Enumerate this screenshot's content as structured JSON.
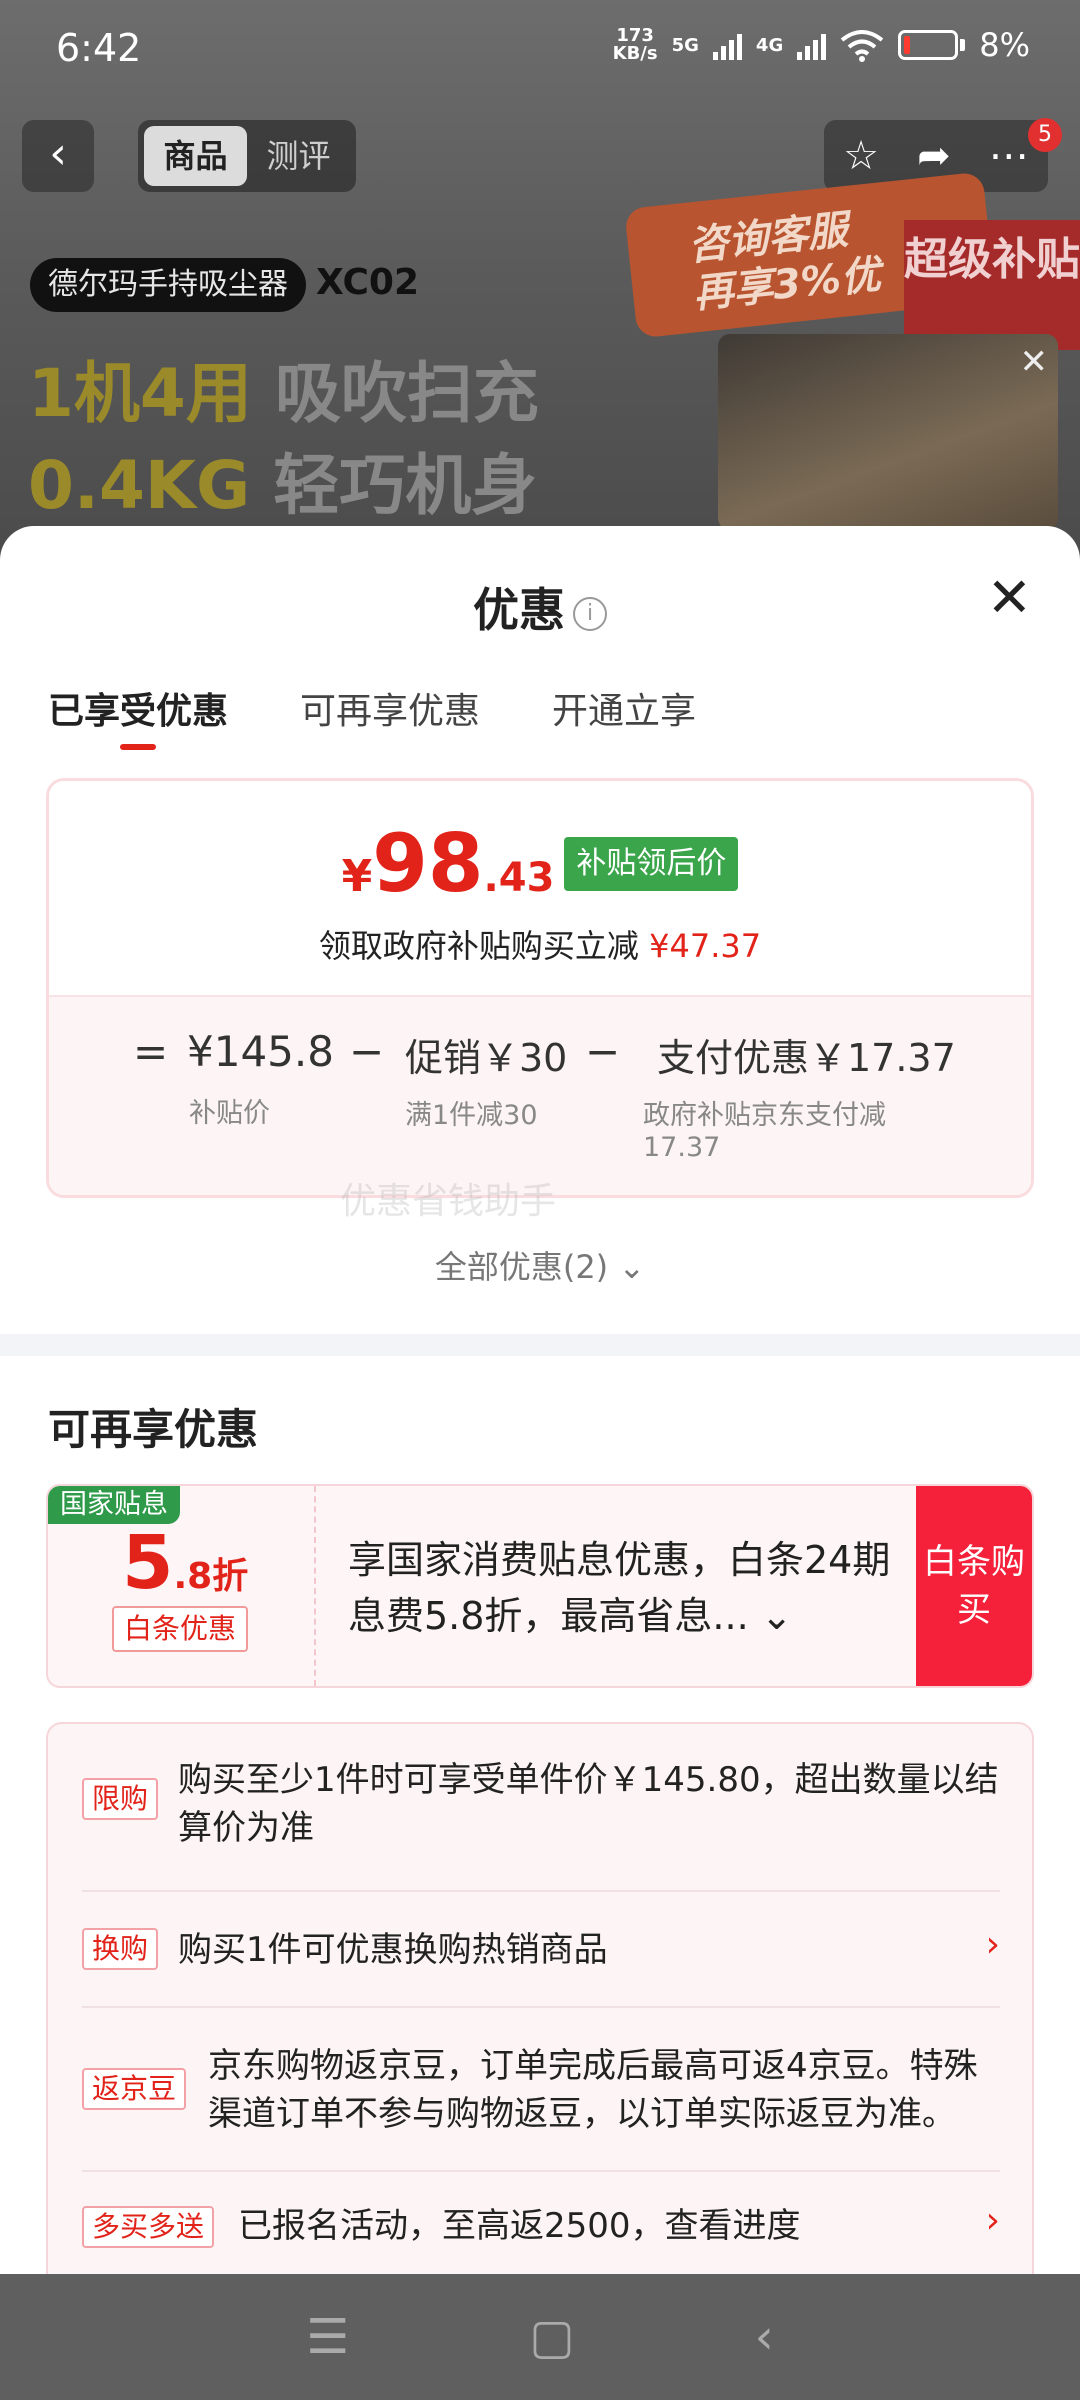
{
  "status_bar": {
    "time": "6:42",
    "net_speed_value": "173",
    "net_speed_unit": "KB/s",
    "sig1": "5G",
    "sig2": "4G",
    "battery": "8%"
  },
  "header": {
    "back_icon": "back-arrow-icon",
    "tabs": [
      {
        "label": "商品"
      },
      {
        "label": "测评"
      }
    ],
    "actions": [
      "star-icon",
      "share-icon",
      "more-icon"
    ],
    "badge_count": "5"
  },
  "product": {
    "tag": "德尔玛手持吸尘器",
    "model": "XC02",
    "slogan1_a": "1机4用",
    "slogan1_b": "吸吹扫充",
    "slogan2_a": "0.4KG",
    "slogan2_b": "轻巧机身",
    "promo_line1": "咨询客服",
    "promo_line2": "再享3%优",
    "promo_red": "超级补贴"
  },
  "sheet": {
    "title": "优惠",
    "tabs": [
      {
        "label": "已享受优惠"
      },
      {
        "label": "可再享优惠"
      },
      {
        "label": "开通立享"
      }
    ],
    "price": {
      "yen": "¥",
      "int": "98",
      "dec": ".43",
      "tag": "补贴领后价",
      "sub_text": "领取政府补贴购买立减",
      "sub_amount": "¥47.37"
    },
    "formula": {
      "eq": "=",
      "base_value": "¥145.8",
      "base_label": "补贴价",
      "minus1": "−",
      "promo_value": "促销￥30",
      "promo_label": "满1件减30",
      "minus2": "−",
      "pay_value": "支付优惠￥17.37",
      "pay_label_line1": "政府补贴京东支付减",
      "pay_label_line2": "17.37"
    },
    "watermark": "优惠省钱助手",
    "all_offers": "全部优惠(2)",
    "section2_title": "可再享优惠",
    "gov_card": {
      "tag": "国家贴息",
      "discount_big": "5",
      "discount_small": ".8折",
      "bt_tag": "白条优惠",
      "text": "享国家消费贴息优惠，白条24期息费5.8折，最高省息...",
      "button": "白条购买"
    },
    "rows": [
      {
        "tag": "限购",
        "text": "购买至少1件时可享受单件价￥145.80，超出数量以结算价为准"
      },
      {
        "tag": "换购",
        "text": "购买1件可优惠换购热销商品"
      },
      {
        "tag": "返京豆",
        "text": "京东购物返京豆，订单完成后最高可返4京豆。特殊渠道订单不参与购物返豆，以订单实际返豆为准。"
      },
      {
        "tag": "多买多送",
        "text": "已报名活动，至高返2500，查看进度"
      }
    ]
  },
  "navbar": {
    "items": [
      "menu-icon",
      "home-icon",
      "back-icon"
    ]
  }
}
